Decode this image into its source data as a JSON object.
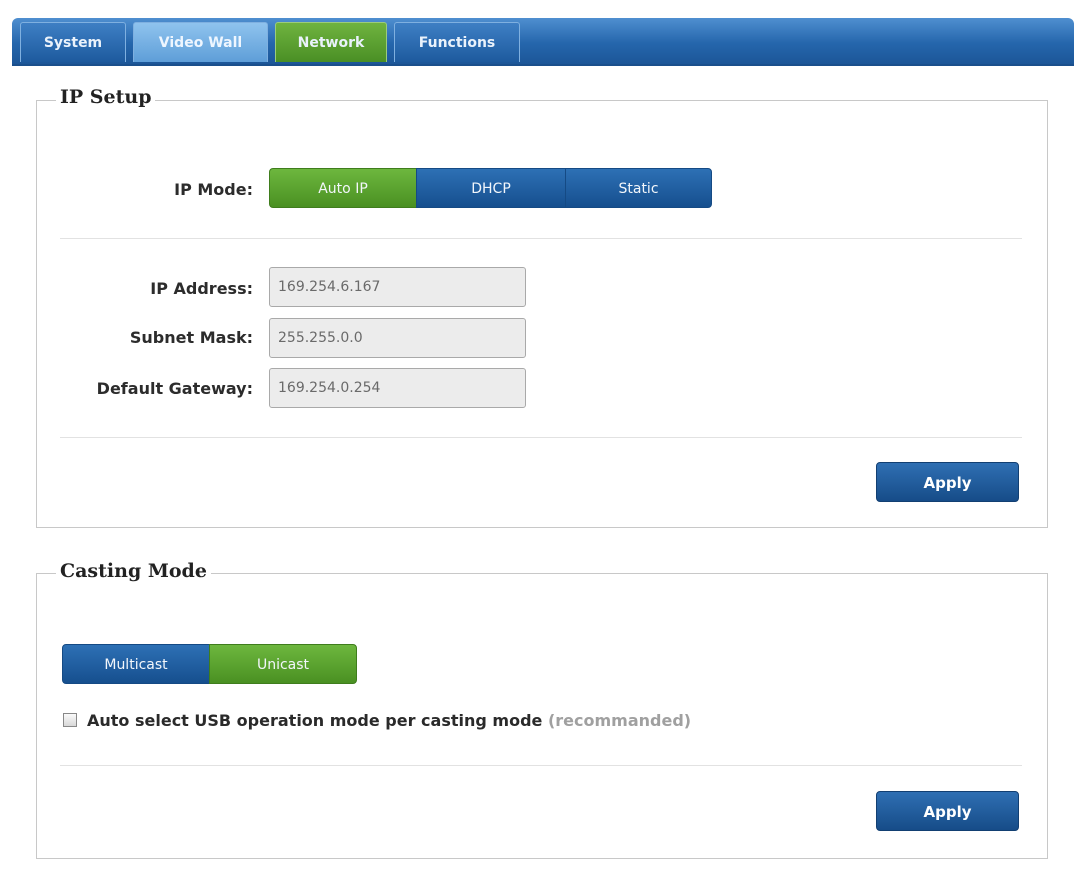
{
  "tabs": {
    "system": "System",
    "video_wall": "Video Wall",
    "network": "Network",
    "functions": "Functions",
    "active": "Network"
  },
  "ip_setup": {
    "title": "IP Setup",
    "mode_label": "IP Mode:",
    "modes": [
      "Auto IP",
      "DHCP",
      "Static"
    ],
    "selected_mode": "Auto IP",
    "ip_address_label": "IP Address:",
    "ip_address": "169.254.6.167",
    "subnet_mask_label": "Subnet Mask:",
    "subnet_mask": "255.255.0.0",
    "gateway_label": "Default Gateway:",
    "gateway": "169.254.0.254",
    "apply_label": "Apply"
  },
  "casting_mode": {
    "title": "Casting Mode",
    "modes": [
      "Multicast",
      "Unicast"
    ],
    "selected_mode": "Unicast",
    "auto_usb_label": "Auto select USB operation mode per casting mode",
    "auto_usb_note": "(recommanded)",
    "auto_usb_checked": false,
    "apply_label": "Apply"
  },
  "colors": {
    "active_green": "#5aa530",
    "button_blue": "#1f5d9f",
    "tabbar_blue": "#2566ac"
  }
}
